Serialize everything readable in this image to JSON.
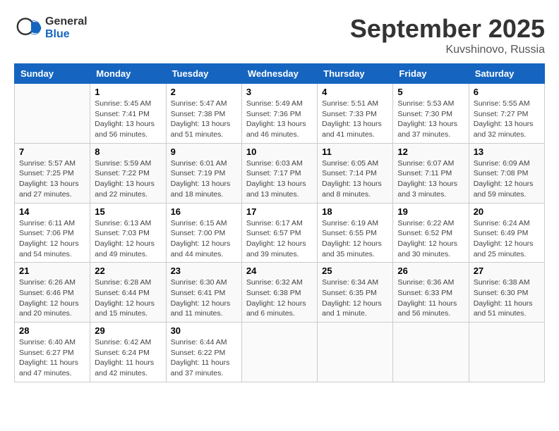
{
  "header": {
    "logo_general": "General",
    "logo_blue": "Blue",
    "month_title": "September 2025",
    "location": "Kuvshinovo, Russia"
  },
  "days_of_week": [
    "Sunday",
    "Monday",
    "Tuesday",
    "Wednesday",
    "Thursday",
    "Friday",
    "Saturday"
  ],
  "weeks": [
    [
      {
        "day": "",
        "info": ""
      },
      {
        "day": "1",
        "info": "Sunrise: 5:45 AM\nSunset: 7:41 PM\nDaylight: 13 hours\nand 56 minutes."
      },
      {
        "day": "2",
        "info": "Sunrise: 5:47 AM\nSunset: 7:38 PM\nDaylight: 13 hours\nand 51 minutes."
      },
      {
        "day": "3",
        "info": "Sunrise: 5:49 AM\nSunset: 7:36 PM\nDaylight: 13 hours\nand 46 minutes."
      },
      {
        "day": "4",
        "info": "Sunrise: 5:51 AM\nSunset: 7:33 PM\nDaylight: 13 hours\nand 41 minutes."
      },
      {
        "day": "5",
        "info": "Sunrise: 5:53 AM\nSunset: 7:30 PM\nDaylight: 13 hours\nand 37 minutes."
      },
      {
        "day": "6",
        "info": "Sunrise: 5:55 AM\nSunset: 7:27 PM\nDaylight: 13 hours\nand 32 minutes."
      }
    ],
    [
      {
        "day": "7",
        "info": "Sunrise: 5:57 AM\nSunset: 7:25 PM\nDaylight: 13 hours\nand 27 minutes."
      },
      {
        "day": "8",
        "info": "Sunrise: 5:59 AM\nSunset: 7:22 PM\nDaylight: 13 hours\nand 22 minutes."
      },
      {
        "day": "9",
        "info": "Sunrise: 6:01 AM\nSunset: 7:19 PM\nDaylight: 13 hours\nand 18 minutes."
      },
      {
        "day": "10",
        "info": "Sunrise: 6:03 AM\nSunset: 7:17 PM\nDaylight: 13 hours\nand 13 minutes."
      },
      {
        "day": "11",
        "info": "Sunrise: 6:05 AM\nSunset: 7:14 PM\nDaylight: 13 hours\nand 8 minutes."
      },
      {
        "day": "12",
        "info": "Sunrise: 6:07 AM\nSunset: 7:11 PM\nDaylight: 13 hours\nand 3 minutes."
      },
      {
        "day": "13",
        "info": "Sunrise: 6:09 AM\nSunset: 7:08 PM\nDaylight: 12 hours\nand 59 minutes."
      }
    ],
    [
      {
        "day": "14",
        "info": "Sunrise: 6:11 AM\nSunset: 7:06 PM\nDaylight: 12 hours\nand 54 minutes."
      },
      {
        "day": "15",
        "info": "Sunrise: 6:13 AM\nSunset: 7:03 PM\nDaylight: 12 hours\nand 49 minutes."
      },
      {
        "day": "16",
        "info": "Sunrise: 6:15 AM\nSunset: 7:00 PM\nDaylight: 12 hours\nand 44 minutes."
      },
      {
        "day": "17",
        "info": "Sunrise: 6:17 AM\nSunset: 6:57 PM\nDaylight: 12 hours\nand 39 minutes."
      },
      {
        "day": "18",
        "info": "Sunrise: 6:19 AM\nSunset: 6:55 PM\nDaylight: 12 hours\nand 35 minutes."
      },
      {
        "day": "19",
        "info": "Sunrise: 6:22 AM\nSunset: 6:52 PM\nDaylight: 12 hours\nand 30 minutes."
      },
      {
        "day": "20",
        "info": "Sunrise: 6:24 AM\nSunset: 6:49 PM\nDaylight: 12 hours\nand 25 minutes."
      }
    ],
    [
      {
        "day": "21",
        "info": "Sunrise: 6:26 AM\nSunset: 6:46 PM\nDaylight: 12 hours\nand 20 minutes."
      },
      {
        "day": "22",
        "info": "Sunrise: 6:28 AM\nSunset: 6:44 PM\nDaylight: 12 hours\nand 15 minutes."
      },
      {
        "day": "23",
        "info": "Sunrise: 6:30 AM\nSunset: 6:41 PM\nDaylight: 12 hours\nand 11 minutes."
      },
      {
        "day": "24",
        "info": "Sunrise: 6:32 AM\nSunset: 6:38 PM\nDaylight: 12 hours\nand 6 minutes."
      },
      {
        "day": "25",
        "info": "Sunrise: 6:34 AM\nSunset: 6:35 PM\nDaylight: 12 hours\nand 1 minute."
      },
      {
        "day": "26",
        "info": "Sunrise: 6:36 AM\nSunset: 6:33 PM\nDaylight: 11 hours\nand 56 minutes."
      },
      {
        "day": "27",
        "info": "Sunrise: 6:38 AM\nSunset: 6:30 PM\nDaylight: 11 hours\nand 51 minutes."
      }
    ],
    [
      {
        "day": "28",
        "info": "Sunrise: 6:40 AM\nSunset: 6:27 PM\nDaylight: 11 hours\nand 47 minutes."
      },
      {
        "day": "29",
        "info": "Sunrise: 6:42 AM\nSunset: 6:24 PM\nDaylight: 11 hours\nand 42 minutes."
      },
      {
        "day": "30",
        "info": "Sunrise: 6:44 AM\nSunset: 6:22 PM\nDaylight: 11 hours\nand 37 minutes."
      },
      {
        "day": "",
        "info": ""
      },
      {
        "day": "",
        "info": ""
      },
      {
        "day": "",
        "info": ""
      },
      {
        "day": "",
        "info": ""
      }
    ]
  ]
}
